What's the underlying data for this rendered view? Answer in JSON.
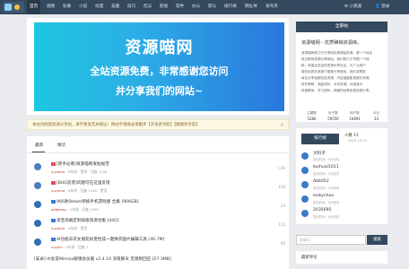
{
  "nav": {
    "items": [
      "首页",
      "视频",
      "轮廓",
      "小说",
      "动漫",
      "美图",
      "技巧",
      "吃瓜",
      "影视",
      "软件",
      "办公",
      "默认",
      "排行榜",
      "网址导",
      "发布页"
    ],
    "right_items": [
      "⚙ 小黑屋",
      "👤 登录"
    ]
  },
  "banner": {
    "title": "资源喵网",
    "line1": "全站资源免费，非常感谢您访问",
    "line2": "并分享我们的网站~"
  },
  "notice": {
    "text": "本站为网盘资源分享站，请不要发无关网址！网站申请收录请戳步【开发者导航】【跳跳免导航】",
    "close": "×"
  },
  "tabs": [
    "最新",
    "精华"
  ],
  "threads": [
    {
      "tag": "red",
      "title": "[新手必看]资源喵网发帖规范",
      "user": "yuydmo",
      "meta": "· 8年前 · 置顶 · 回复 2158",
      "count": "1.0k"
    },
    {
      "tag": "red",
      "title": "[BUG反馈]问题可在这里反馈",
      "user": "yuydmo",
      "meta": "· 8年前 · 回复 1046 · 置顶",
      "count": "156"
    },
    {
      "tag": "blue",
      "title": "966款Steam移植手机游戏版 合集 [906GB]",
      "user": "qzfgmwy",
      "meta": "· 2年前 · 回复 1065",
      "count": "23"
    },
    {
      "tag": "blue",
      "title": "某宝高端定制高级资源合集 [44G]",
      "user": "yuydmo",
      "meta": "· 9年前 · 置顶",
      "count": "112"
    },
    {
      "tag": "blue",
      "title": "AI功能去衣女朋友好变性成一键换衣图片编辑工具 [40.7M]",
      "user": "luoyhn",
      "meta": "· 9年前 · 回复 1",
      "count": "45"
    },
    {
      "tag": "blue",
      "title": "[安卓] AI女友Mimico解锁会员版 v2.4.14 深夜聊天 无限制回应 [27.3MB]",
      "user": "",
      "meta": "",
      "count": ""
    }
  ],
  "sidebar": {
    "title": "全部帖",
    "site_name": "资源喵网 - 优质稀缺资源库。",
    "desc": [
      "资源喵网致力于分享网优质稀缺资源，是一个综合",
      "类互联网资源分享网站。我们致力于挖掘一个纯",
      "粹，和谐且自由的资源分享社区，为广大用户",
      "提供优质的资源下载和分享服务。我们将帮助",
      "每位分享者都包含资源，内容涵盖影视娱乐资源,",
      "软件教程、电脑资料、手机资源、动漫音乐、",
      "科普教育、学习资料、网赚项目等多类资源分享。"
    ],
    "stats": [
      {
        "label": "主题数",
        "value": "5286"
      },
      {
        "label": "帖子数",
        "value": "59556"
      },
      {
        "label": "用户数",
        "value": "10891"
      },
      {
        "label": "今日",
        "value": "33"
      }
    ]
  },
  "users": {
    "tab_label": "排行榜",
    "count_label": "人数 11",
    "date": "2025-10-23",
    "list": [
      {
        "name": "大科子",
        "time": "发帖时间：6分钟前"
      },
      {
        "name": "baihuai1011",
        "time": "发帖时间：6分钟前"
      },
      {
        "name": "Abb052",
        "time": "发帖时间：6分钟前"
      },
      {
        "name": "lookychao",
        "time": "发帖时间：6分钟前"
      },
      {
        "name": "2035695",
        "time": "发帖时间：6分钟前"
      }
    ]
  },
  "search": {
    "placeholder": "关键词",
    "button": "搜索"
  },
  "side_footer": "最新评论"
}
